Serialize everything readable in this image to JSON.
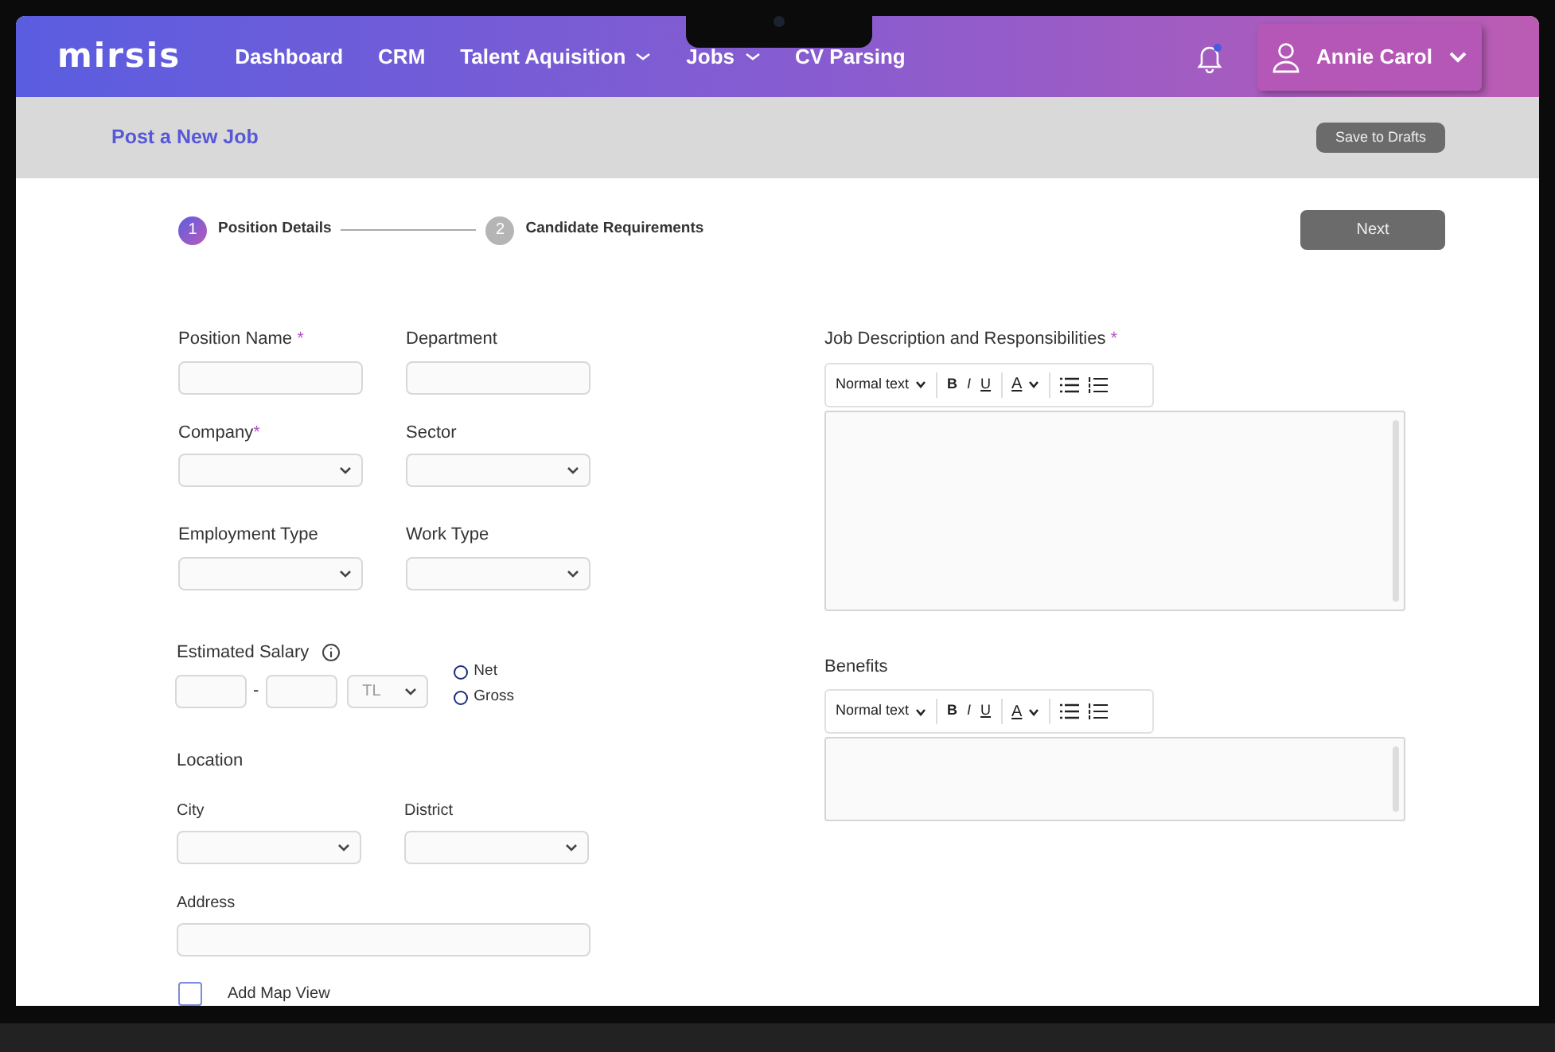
{
  "logo": "mirsis",
  "nav": [
    {
      "label": "Dashboard",
      "dropdown": false
    },
    {
      "label": "CRM",
      "dropdown": false
    },
    {
      "label": "Talent Aquisition",
      "dropdown": true
    },
    {
      "label": "Jobs",
      "dropdown": true
    },
    {
      "label": "CV Parsing",
      "dropdown": false
    }
  ],
  "notifications": {
    "unread": true
  },
  "user": {
    "name": "Annie Carol"
  },
  "page_title": "Post a New Job",
  "save_button": "Save to Drafts",
  "steps": [
    {
      "number": "1",
      "label": "Position Details",
      "selected": true
    },
    {
      "number": "2",
      "label": "Candidate Requirements",
      "selected": false
    }
  ],
  "next_button": "Next",
  "field_rows": [
    [
      {
        "label": "Position Name",
        "required_mark": " *",
        "kind": "text"
      },
      {
        "label": "Department",
        "kind": "text"
      }
    ],
    [
      {
        "label": "Company",
        "required_mark": "*",
        "kind": "select"
      },
      {
        "label": "Sector",
        "kind": "select"
      }
    ],
    [
      {
        "label": "Employment Type",
        "kind": "select"
      },
      {
        "label": "Work Type",
        "kind": "select"
      }
    ]
  ],
  "salary": {
    "label": "Estimated Salary",
    "separator": "-",
    "currency": "TL",
    "options": [
      {
        "label": "Net",
        "selected": false
      },
      {
        "label": "Gross",
        "selected": false
      }
    ]
  },
  "location": {
    "heading": "Location",
    "rows": [
      [
        {
          "label": "City",
          "kind": "select"
        },
        {
          "label": "District",
          "kind": "select"
        }
      ],
      [
        {
          "label": "Address",
          "kind": "wide"
        }
      ]
    ]
  },
  "map_view": {
    "label": "Add Map View",
    "checked": false
  },
  "editors": [
    {
      "label": "Job Description and Responsibilities",
      "required_mark": " *",
      "kind": "tall",
      "toolbar": {
        "style": "Normal text",
        "bold": "B",
        "italic": "I",
        "underline": "U",
        "font_color_label": "A"
      }
    },
    {
      "label": "Benefits",
      "kind": "short",
      "toolbar": {
        "style": "Normal text",
        "bold": "B",
        "italic": "I",
        "underline": "U",
        "font_color_label": "A"
      }
    }
  ]
}
